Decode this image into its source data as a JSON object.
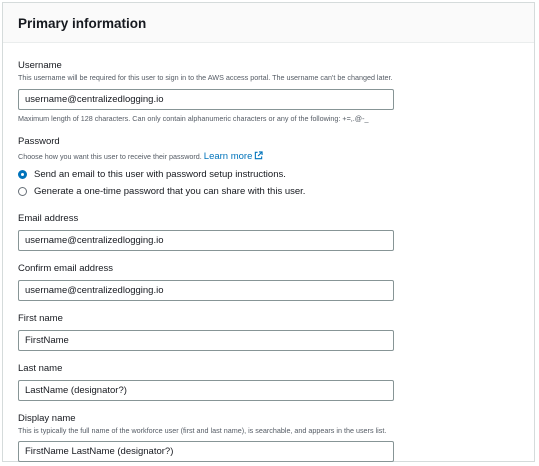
{
  "panel": {
    "title": "Primary information"
  },
  "username": {
    "label": "Username",
    "description": "This username will be required for this user to sign in to the AWS access portal. The username can't be changed later.",
    "value": "username@centralizedlogging.io",
    "constraint": "Maximum length of 128 characters. Can only contain alphanumeric characters or any of the following: +=,.@-_"
  },
  "password": {
    "label": "Password",
    "description": "Choose how you want this user to receive their password.",
    "learn_more": "Learn more",
    "options": [
      {
        "label": "Send an email to this user with password setup instructions.",
        "selected": true
      },
      {
        "label": "Generate a one-time password that you can share with this user.",
        "selected": false
      }
    ]
  },
  "email": {
    "label": "Email address",
    "value": "username@centralizedlogging.io"
  },
  "confirm_email": {
    "label": "Confirm email address",
    "value": "username@centralizedlogging.io"
  },
  "first_name": {
    "label": "First name",
    "value": "FirstName"
  },
  "last_name": {
    "label": "Last name",
    "value": "LastName (designator?)"
  },
  "display_name": {
    "label": "Display name",
    "description": "This is typically the full name of the workforce user (first and last name), is searchable, and appears in the users list.",
    "value": "FirstName LastName (designator?)"
  },
  "colors": {
    "accent": "#0073bb",
    "border": "#879596"
  }
}
